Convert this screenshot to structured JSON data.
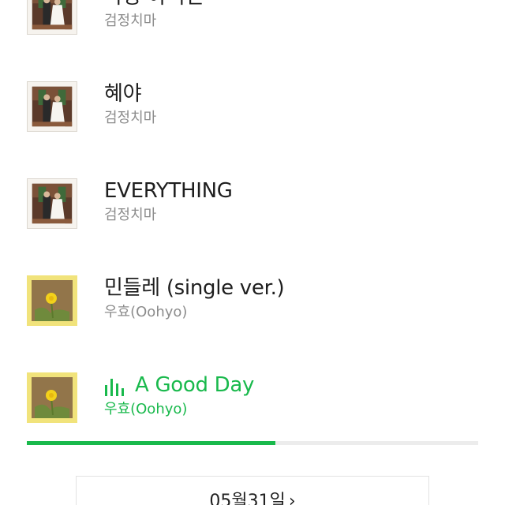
{
  "colors": {
    "accent": "#19b94c",
    "title_text": "#1e1e1e",
    "artist_text": "#8c8c8c",
    "progress_track": "#ececec"
  },
  "tracks": [
    {
      "title": "나랑 아니면",
      "artist": "검정치마",
      "art": "wedding-photo",
      "playing": false
    },
    {
      "title": "혜야",
      "artist": "검정치마",
      "art": "wedding-photo",
      "playing": false
    },
    {
      "title": "EVERYTHING",
      "artist": "검정치마",
      "art": "wedding-photo",
      "playing": false
    },
    {
      "title": "민들레 (single ver.)",
      "artist": "우효(Oohyo)",
      "art": "dandelion-photo",
      "playing": false
    },
    {
      "title": "A Good Day",
      "artist": "우효(Oohyo)",
      "art": "dandelion-photo",
      "playing": true
    }
  ],
  "now_playing": {
    "icon": "equalizer-icon",
    "progress_fraction": 0.55
  },
  "date_button": {
    "label": "05월31일",
    "icon": "chevron-right-icon",
    "glyph": "›"
  }
}
